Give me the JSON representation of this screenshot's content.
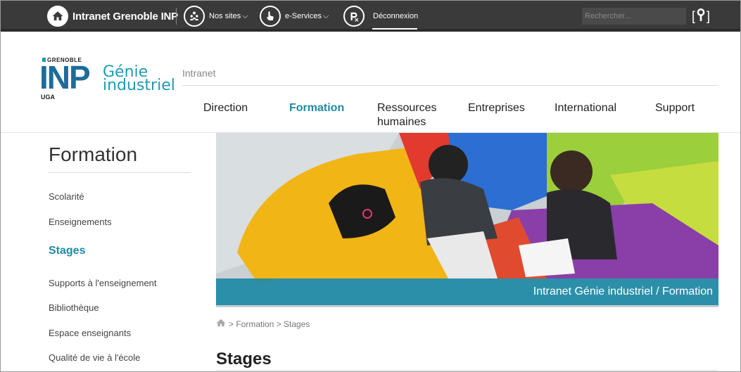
{
  "topbar": {
    "home_title": "Intranet Grenoble INP",
    "sites_label": "Nos sites",
    "services_label": "e-Services",
    "logout_label": "Déconnexion",
    "search_placeholder": "Rechercher...",
    "chevron": "⌵",
    "icons": [
      "home-icon",
      "people-icon",
      "touch-icon",
      "logout-icon",
      "search-icon"
    ]
  },
  "header": {
    "logo": {
      "grenoble": "GRENOBLE",
      "inp": "INP",
      "uga": "UGA",
      "line1": "Génie",
      "line2": "industriel"
    },
    "intranet_label": "Intranet",
    "nav": [
      {
        "label": "Direction"
      },
      {
        "label": "Formation"
      },
      {
        "label": "Ressources humaines"
      },
      {
        "label": "Entreprises"
      },
      {
        "label": "International"
      },
      {
        "label": "Support"
      }
    ]
  },
  "sidebar": {
    "title": "Formation",
    "items": [
      {
        "label": "Scolarité"
      },
      {
        "label": "Enseignements"
      },
      {
        "label": "Stages"
      },
      {
        "label": "Supports à l'enseignement"
      },
      {
        "label": "Bibliothèque"
      },
      {
        "label": "Espace enseignants"
      },
      {
        "label": "Qualité de vie à l'école"
      }
    ]
  },
  "hero": {
    "caption": "Intranet Génie industriel / Formation"
  },
  "breadcrumb": {
    "text": "> Formation > Stages"
  },
  "page": {
    "title": "Stages"
  },
  "colors": {
    "topbar": "#3a3a3a",
    "accent": "#1e8aa5",
    "logo_blue": "#1d6c9a"
  }
}
